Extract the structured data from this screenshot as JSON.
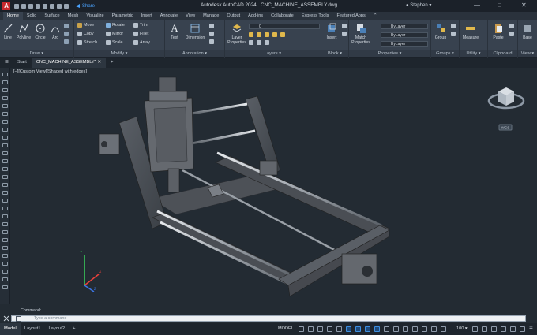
{
  "app": {
    "title": "Autodesk AutoCAD 2024",
    "file": "CNC_MACHINE_ASSEMBLY.dwg",
    "logo_letter": "A",
    "share_label": "Share",
    "user": "Stephen"
  },
  "ribbon_tabs": [
    "Home",
    "Solid",
    "Surface",
    "Mesh",
    "Visualize",
    "Parametric",
    "Insert",
    "Annotate",
    "View",
    "Manage",
    "Output",
    "Add-ins",
    "Collaborate",
    "Express Tools",
    "Featured Apps"
  ],
  "active_ribbon_tab": "Home",
  "panels": {
    "draw": {
      "title": "Draw",
      "line": "Line",
      "polyline": "Polyline",
      "circle": "Circle",
      "arc": "Arc"
    },
    "modify": {
      "title": "Modify",
      "move": "Move",
      "rotate": "Rotate",
      "trim": "Trim",
      "copy": "Copy",
      "mirror": "Mirror",
      "fillet": "Fillet",
      "stretch": "Stretch",
      "scale": "Scale",
      "array": "Array"
    },
    "annotation": {
      "title": "Annotation",
      "text": "Text",
      "dimension": "Dimension"
    },
    "layers": {
      "title": "Layers",
      "layer_properties": "Layer Properties",
      "current_layer": "0"
    },
    "block": {
      "title": "Block",
      "insert": "Insert"
    },
    "properties": {
      "title": "Properties",
      "match": "Match Properties",
      "color": "ByLayer",
      "linetype": "ByLayer",
      "lineweight": "ByLayer"
    },
    "groups": {
      "title": "Groups",
      "group": "Group"
    },
    "utilities": {
      "title": "Utility",
      "measure": "Measure"
    },
    "clipboard": {
      "title": "Clipboard",
      "paste": "Paste"
    },
    "view": {
      "title": "View",
      "base": "Base"
    }
  },
  "file_tabs": {
    "start": "Start",
    "active": "CNC_MACHINE_ASSEMBLY*"
  },
  "viewport": {
    "label": "[−][Custom View][Shaded with edges]",
    "viewcube_face": "",
    "wcs_label": "WCS",
    "ucs": {
      "x": "X",
      "y": "Y",
      "z": "Z"
    }
  },
  "command": {
    "history": "Command:",
    "placeholder": "Type a command"
  },
  "status": {
    "model_tab": "Model",
    "layouts": [
      "Layout1",
      "Layout2"
    ],
    "mode": "MODEL",
    "scale": "1:1 / 100%",
    "zoom_text": "100"
  },
  "colors": {
    "accent": "#1e6fd9",
    "titlebar": "#1b2129",
    "ribbon": "#38424f",
    "viewport": "#232b33",
    "logo": "#c8282d"
  }
}
